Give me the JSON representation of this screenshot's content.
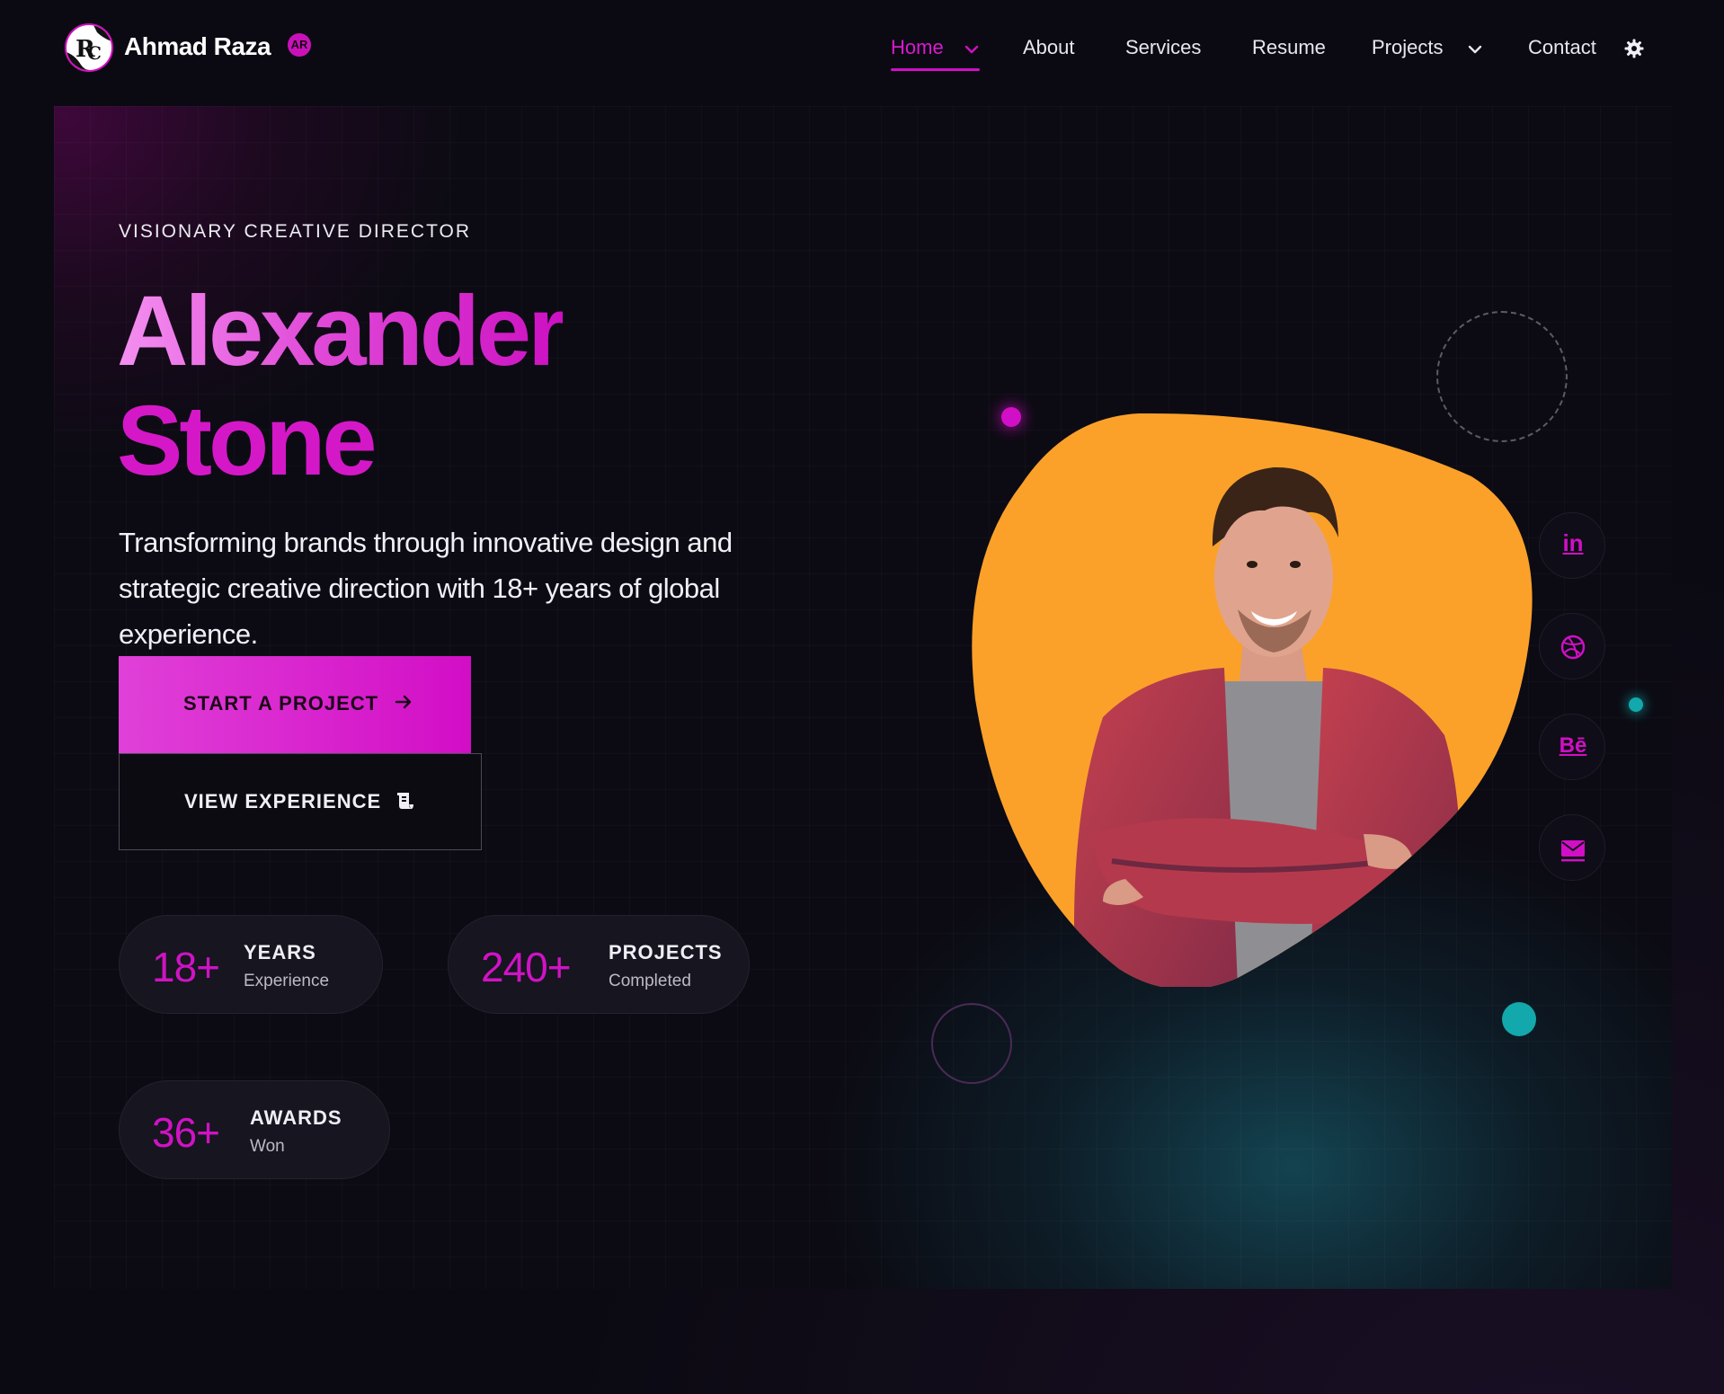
{
  "brand": {
    "name": "Ahmad Raza",
    "badge": "AR",
    "logo_letters": "RC"
  },
  "nav": {
    "items": [
      {
        "label": "Home",
        "active": true,
        "dropdown": true
      },
      {
        "label": "About"
      },
      {
        "label": "Services"
      },
      {
        "label": "Resume"
      },
      {
        "label": "Projects",
        "dropdown": true
      },
      {
        "label": "Contact"
      }
    ],
    "theme_icon": "gear-icon"
  },
  "hero": {
    "eyebrow": "VISIONARY CREATIVE DIRECTOR",
    "name_first": "Alexander",
    "name_last": "Stone",
    "lede": "Transforming brands through innovative design and strategic creative direction with 18+ years of global experience.",
    "primary_cta": {
      "label": "START A PROJECT",
      "icon": "arrow-right-icon"
    },
    "secondary_cta": {
      "label": "VIEW EXPERIENCE",
      "icon": "scroll-icon"
    }
  },
  "stats": [
    {
      "value": "18+",
      "title": "YEARS",
      "subtitle": "Experience"
    },
    {
      "value": "240+",
      "title": "PROJECTS",
      "subtitle": "Completed"
    },
    {
      "value": "36+",
      "title": "AWARDS",
      "subtitle": "Won"
    }
  ],
  "social": [
    {
      "name": "linkedin-icon",
      "text": "in"
    },
    {
      "name": "dribbble-icon"
    },
    {
      "name": "behance-icon",
      "text": "Bē"
    },
    {
      "name": "mail-icon"
    }
  ],
  "colors": {
    "accent": "#d10fc6",
    "accent_light": "#f490f0",
    "teal": "#12a8ac",
    "photo_bg": "#fba12a",
    "background": "#0b0a12"
  }
}
